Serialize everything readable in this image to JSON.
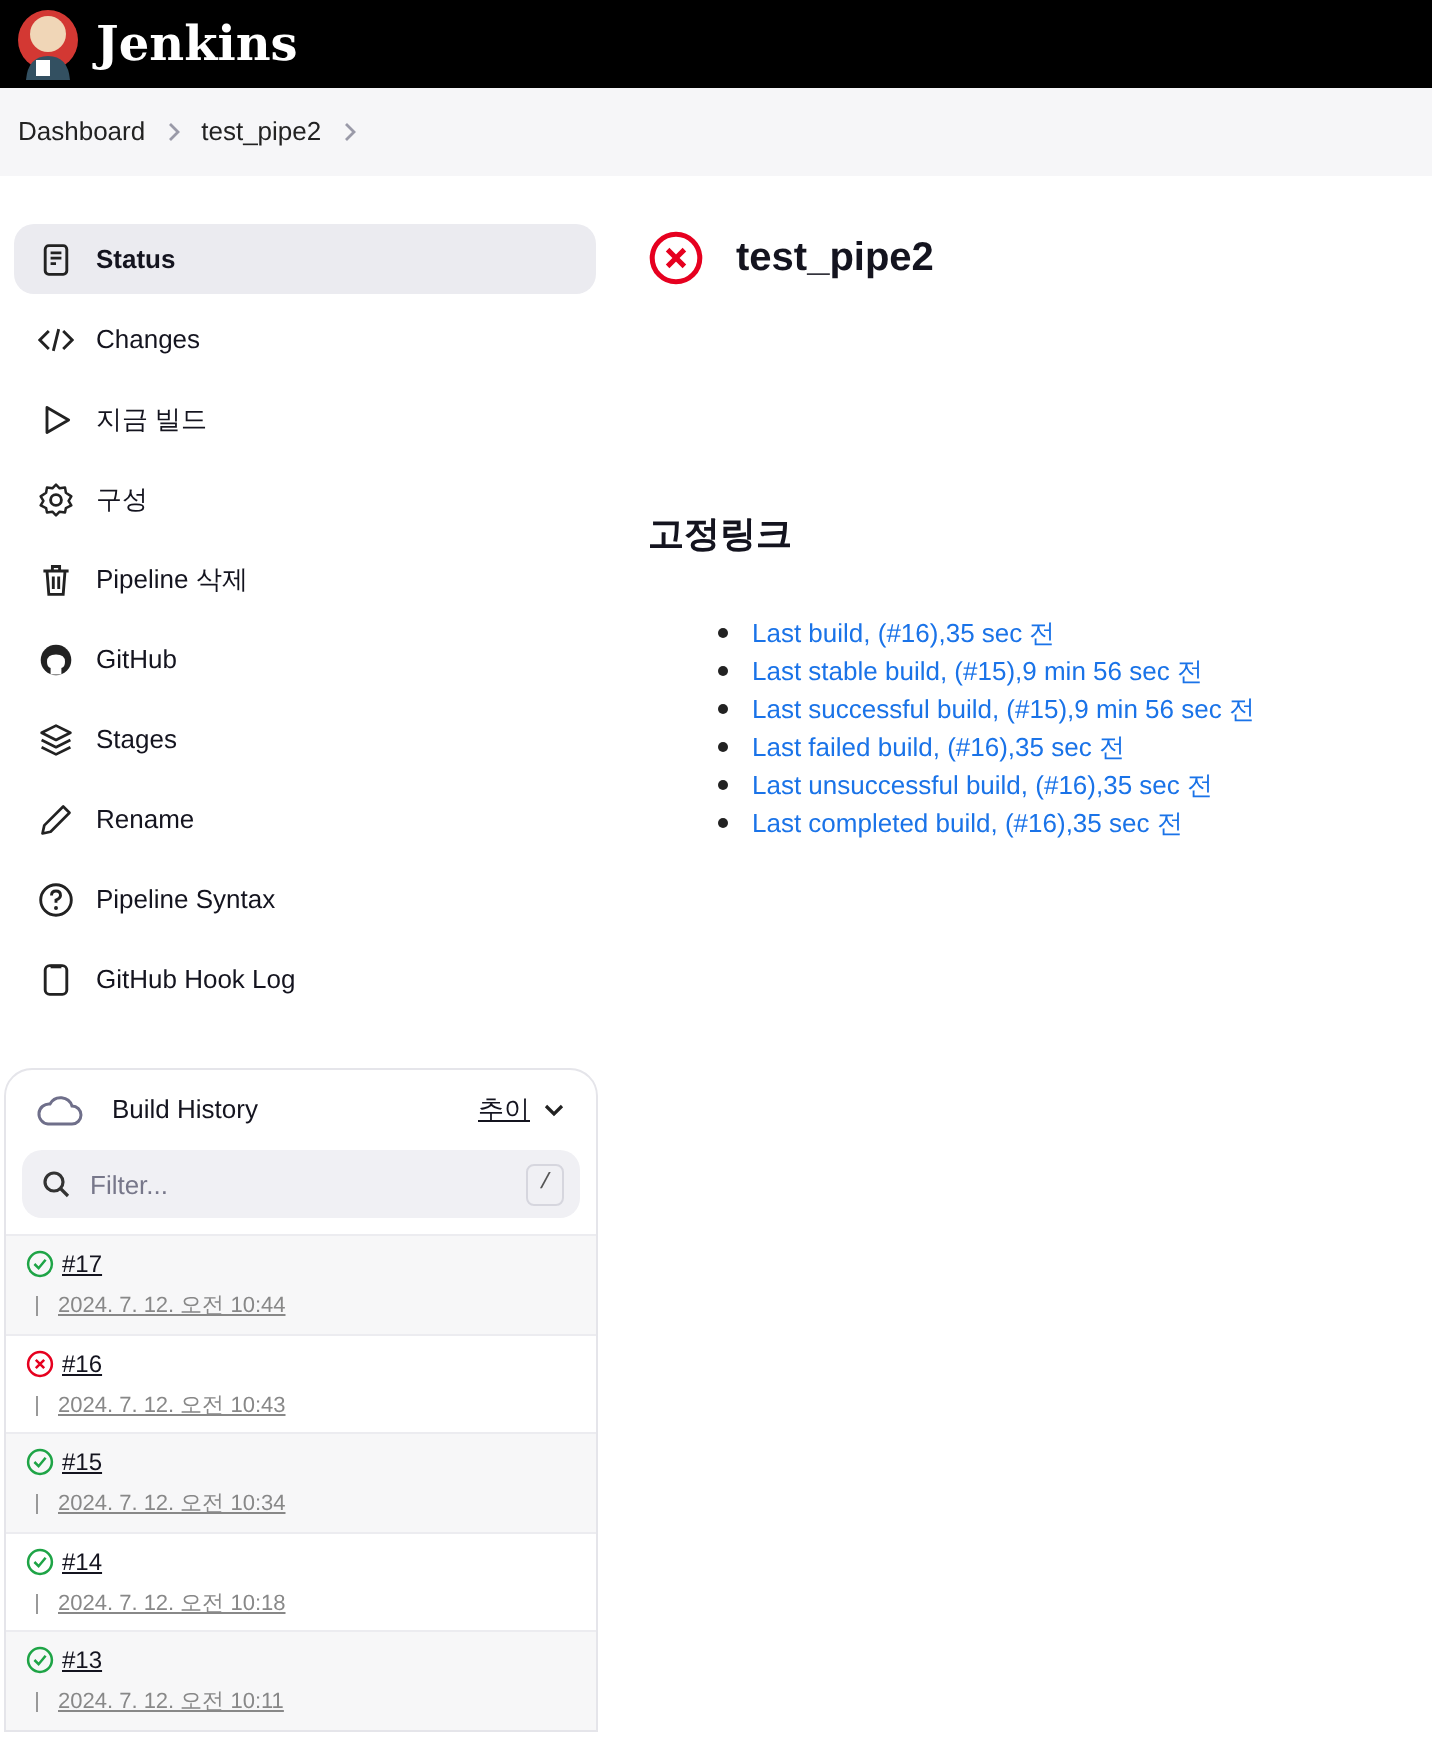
{
  "header": {
    "title": "Jenkins"
  },
  "breadcrumb": [
    "Dashboard",
    "test_pipe2"
  ],
  "sidebar": {
    "items": [
      {
        "label": "Status",
        "kind": "document",
        "selected": true
      },
      {
        "label": "Changes",
        "kind": "code",
        "selected": false
      },
      {
        "label": "지금 빌드",
        "kind": "play",
        "selected": false
      },
      {
        "label": "구성",
        "kind": "gear",
        "selected": false
      },
      {
        "label": "Pipeline 삭제",
        "kind": "trash",
        "selected": false
      },
      {
        "label": "GitHub",
        "kind": "github",
        "selected": false
      },
      {
        "label": "Stages",
        "kind": "layers",
        "selected": false
      },
      {
        "label": "Rename",
        "kind": "pencil",
        "selected": false
      },
      {
        "label": "Pipeline Syntax",
        "kind": "help",
        "selected": false
      },
      {
        "label": "GitHub Hook Log",
        "kind": "clipboard",
        "selected": false
      }
    ]
  },
  "build_history": {
    "title": "Build History",
    "trend": "추이",
    "filter": {
      "placeholder": "Filter...",
      "shortcut": "/"
    },
    "builds": [
      {
        "number": "#17",
        "time": "2024. 7. 12. 오전 10:44",
        "failed": false
      },
      {
        "number": "#16",
        "time": "2024. 7. 12. 오전 10:43",
        "failed": true
      },
      {
        "number": "#15",
        "time": "2024. 7. 12. 오전 10:34",
        "failed": false
      },
      {
        "number": "#14",
        "time": "2024. 7. 12. 오전 10:18",
        "failed": false
      },
      {
        "number": "#13",
        "time": "2024. 7. 12. 오전 10:11",
        "failed": false
      }
    ]
  },
  "main": {
    "title": "test_pipe2",
    "failed": true,
    "permalinks_heading": "고정링크",
    "permalinks": [
      "Last build, (#16),35 sec 전",
      "Last stable build, (#15),9 min 56 sec 전",
      "Last successful build, (#15),9 min 56 sec 전",
      "Last failed build, (#16),35 sec 전",
      "Last unsuccessful build, (#16),35 sec 전",
      "Last completed build, (#16),35 sec 전"
    ]
  }
}
